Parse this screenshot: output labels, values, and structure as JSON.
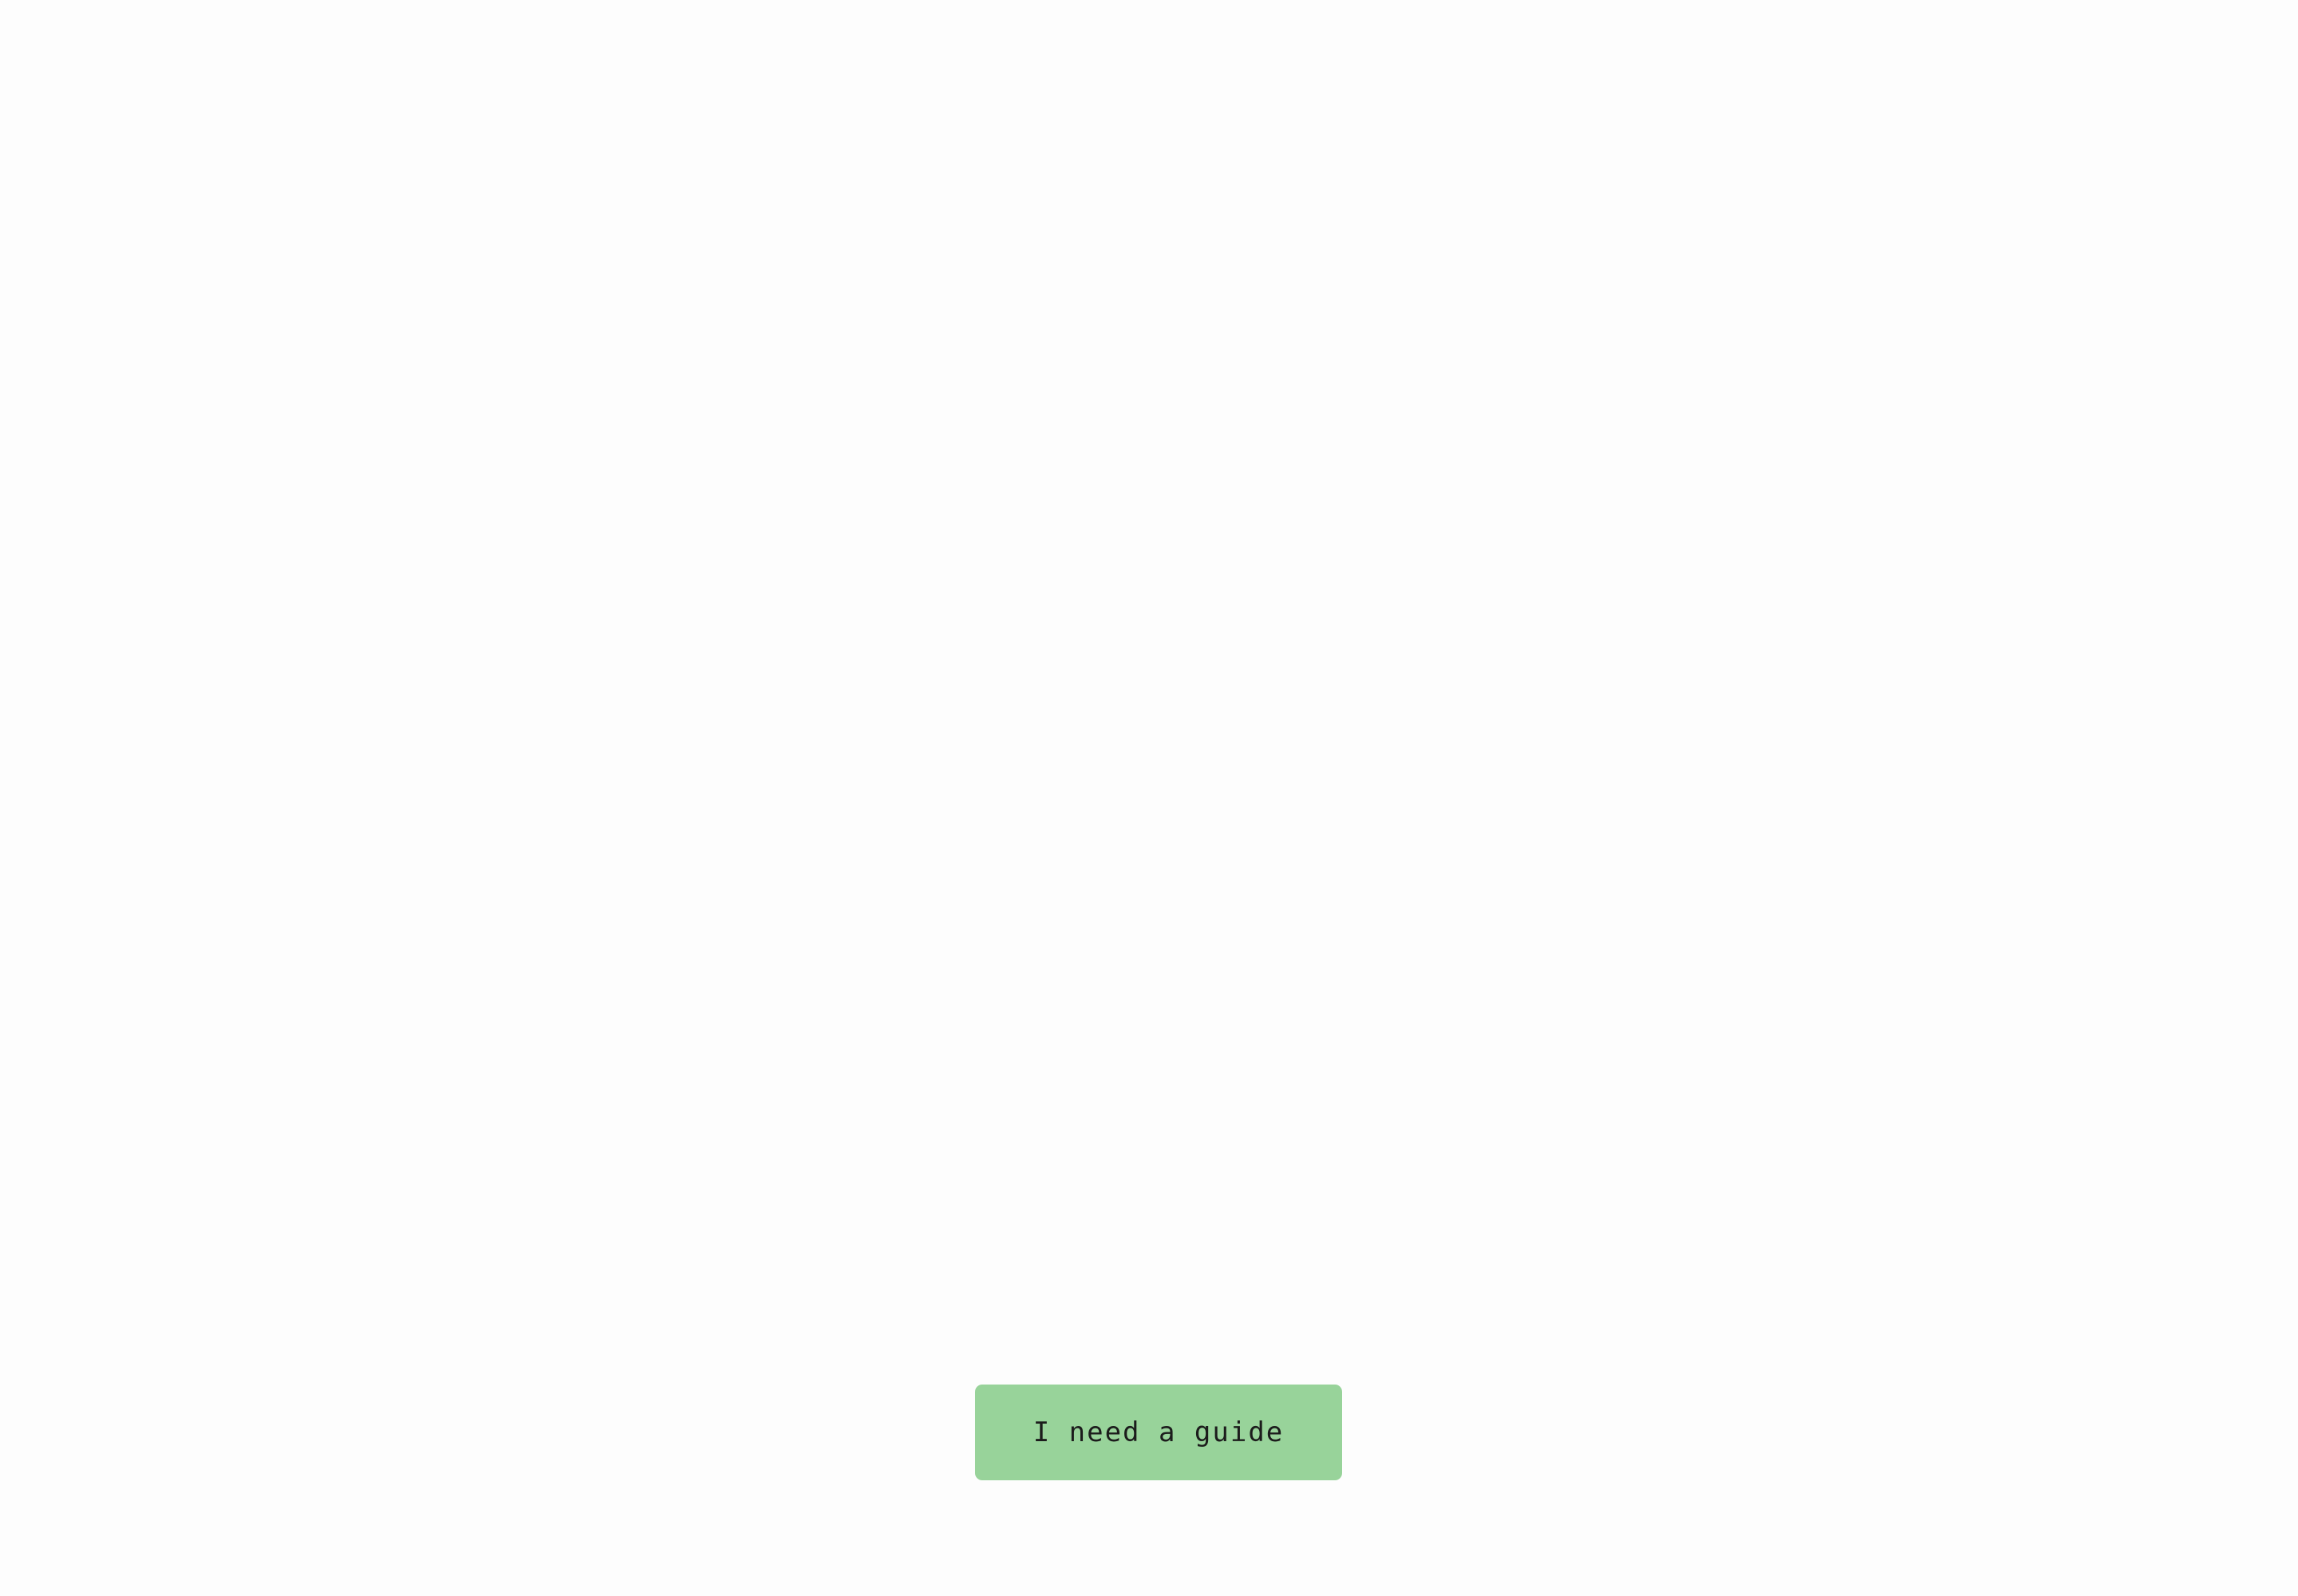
{
  "main": {
    "guide_button_label": "I need a guide"
  },
  "colors": {
    "background": "#fdfdfd",
    "button_background": "#98d39a",
    "button_text": "#1c1c1c"
  }
}
